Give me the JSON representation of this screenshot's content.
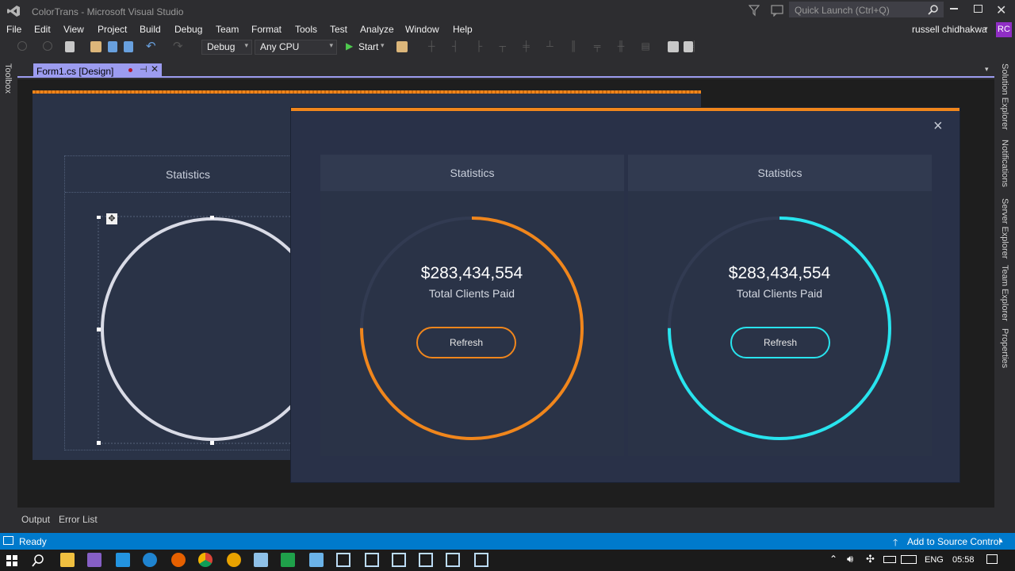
{
  "window": {
    "title": "ColorTrans - Microsoft Visual Studio",
    "quick_launch_placeholder": "Quick Launch (Ctrl+Q)"
  },
  "menu": [
    "File",
    "Edit",
    "View",
    "Project",
    "Build",
    "Debug",
    "Team",
    "Format",
    "Tools",
    "Test",
    "Analyze",
    "Window",
    "Help"
  ],
  "user": {
    "name": "russell chidhakwa",
    "initials": "RC"
  },
  "toolbar": {
    "configuration": "Debug",
    "platform": "Any CPU",
    "start_label": "Start"
  },
  "doc_tab": {
    "label": "Form1.cs [Design]"
  },
  "side_panels": {
    "left": "Toolbox",
    "right": [
      "Solution Explorer",
      "Notifications",
      "Server Explorer",
      "Team Explorer",
      "Properties"
    ]
  },
  "designer": {
    "statistics_label": "Statistics"
  },
  "preview": {
    "close_label": "×",
    "cards": [
      {
        "header": "Statistics",
        "amount": "$283,434,554",
        "caption": "Total Clients Paid",
        "button": "Refresh",
        "accent": "#f0861c",
        "progress": 0.75
      },
      {
        "header": "Statistics",
        "amount": "$283,434,554",
        "caption": "Total Clients Paid",
        "button": "Refresh",
        "accent": "#28e4ee",
        "progress": 0.75
      }
    ]
  },
  "bottom_tabs": [
    "Output",
    "Error List"
  ],
  "status": {
    "text": "Ready",
    "source_control": "Add to Source Control"
  },
  "tray": {
    "language": "ENG",
    "time": "05:58"
  },
  "colors": {
    "vs_accent": "#007acc",
    "designer_bg": "#2a3347",
    "orange_accent": "#f0861c",
    "cyan_accent": "#28e4ee"
  }
}
